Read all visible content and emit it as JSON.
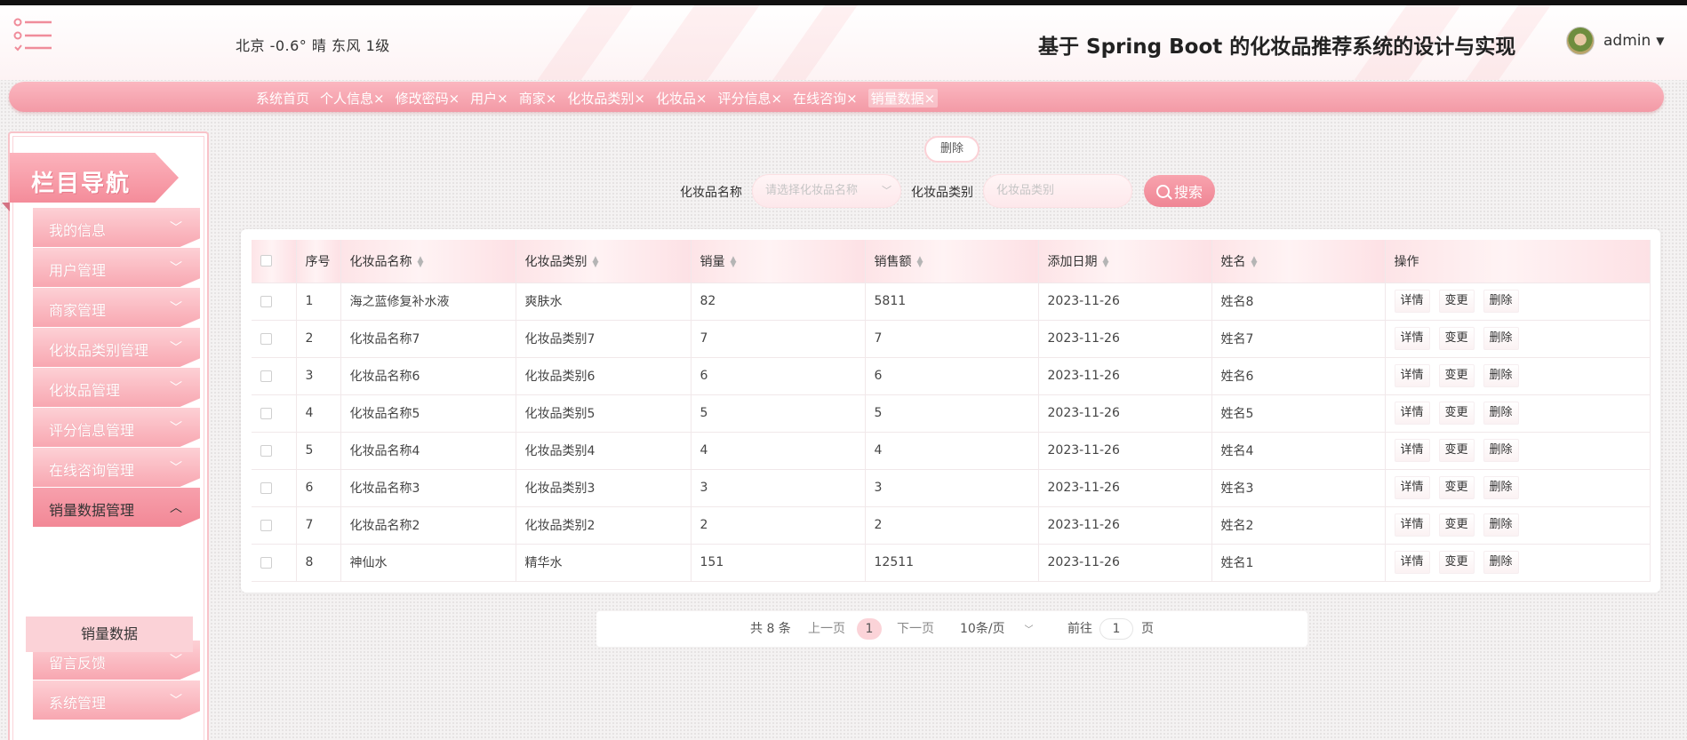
{
  "header": {
    "weather": "北京  -0.6°  晴  东风  1级",
    "title": "基于 Spring Boot 的化妆品推荐系统的设计与实现",
    "username": "admin"
  },
  "tabs": [
    "系统首页",
    "个人信息×",
    "修改密码×",
    "用户×",
    "商家×",
    "化妆品类别×",
    "化妆品×",
    "评分信息×",
    "在线咨询×",
    "销量数据×"
  ],
  "sidebar": {
    "banner": "栏目导航",
    "items": [
      {
        "label": "我的信息"
      },
      {
        "label": "用户管理"
      },
      {
        "label": "商家管理"
      },
      {
        "label": "化妆品类别管理"
      },
      {
        "label": "化妆品管理"
      },
      {
        "label": "评分信息管理"
      },
      {
        "label": "在线咨询管理"
      },
      {
        "label": "销量数据管理"
      },
      {
        "label": "留言反馈"
      },
      {
        "label": "系统管理"
      }
    ],
    "subitem": "销量数据"
  },
  "actions": {
    "delete": "删除",
    "search": "搜索"
  },
  "filters": {
    "name_label": "化妆品名称",
    "name_placeholder": "请选择化妆品名称",
    "category_label": "化妆品类别",
    "category_placeholder": "化妆品类别"
  },
  "table": {
    "headers": [
      "序号",
      "化妆品名称",
      "化妆品类别",
      "销量",
      "销售额",
      "添加日期",
      "姓名",
      "操作"
    ],
    "rows": [
      {
        "no": "1",
        "name": "海之蓝修复补水液",
        "category": "爽肤水",
        "sales": "82",
        "amount": "5811",
        "date": "2023-11-26",
        "person": "姓名8"
      },
      {
        "no": "2",
        "name": "化妆品名称7",
        "category": "化妆品类别7",
        "sales": "7",
        "amount": "7",
        "date": "2023-11-26",
        "person": "姓名7"
      },
      {
        "no": "3",
        "name": "化妆品名称6",
        "category": "化妆品类别6",
        "sales": "6",
        "amount": "6",
        "date": "2023-11-26",
        "person": "姓名6"
      },
      {
        "no": "4",
        "name": "化妆品名称5",
        "category": "化妆品类别5",
        "sales": "5",
        "amount": "5",
        "date": "2023-11-26",
        "person": "姓名5"
      },
      {
        "no": "5",
        "name": "化妆品名称4",
        "category": "化妆品类别4",
        "sales": "4",
        "amount": "4",
        "date": "2023-11-26",
        "person": "姓名4"
      },
      {
        "no": "6",
        "name": "化妆品名称3",
        "category": "化妆品类别3",
        "sales": "3",
        "amount": "3",
        "date": "2023-11-26",
        "person": "姓名3"
      },
      {
        "no": "7",
        "name": "化妆品名称2",
        "category": "化妆品类别2",
        "sales": "2",
        "amount": "2",
        "date": "2023-11-26",
        "person": "姓名2"
      },
      {
        "no": "8",
        "name": "神仙水",
        "category": "精华水",
        "sales": "151",
        "amount": "12511",
        "date": "2023-11-26",
        "person": "姓名1"
      }
    ],
    "ops": {
      "detail": "详情",
      "edit": "变更",
      "delete": "删除"
    }
  },
  "pagination": {
    "total": "共 8 条",
    "prev": "上一页",
    "current": "1",
    "next": "下一页",
    "page_size": "10条/页",
    "goto_label": "前往",
    "goto_value": "1",
    "page_unit": "页"
  },
  "colors": {
    "accent": "#f39aa6",
    "accent_light": "#fbd3d8"
  }
}
